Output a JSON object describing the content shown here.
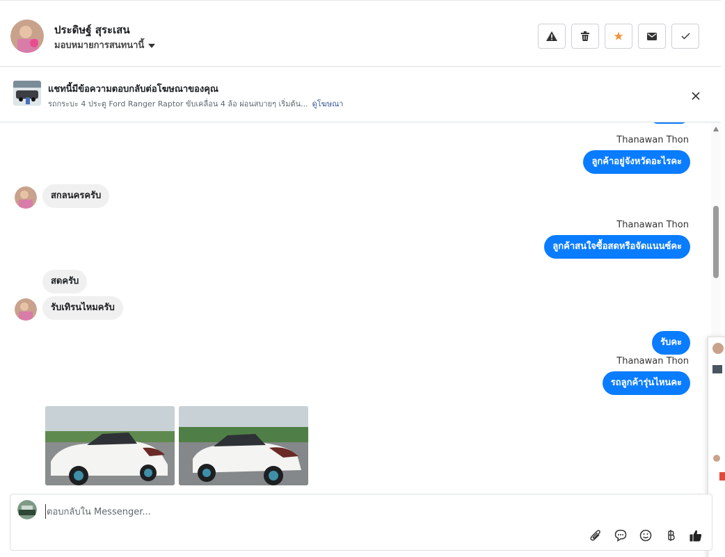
{
  "header": {
    "contact_name": "ประดิษฐ์ สุระเสน",
    "assign_label": "มอบหมายการสนทนานี้"
  },
  "ad_banner": {
    "title": "แชทนี้มีข้อความตอบกลับต่อโฆษณาของคุณ",
    "description": "รถกระบะ 4 ประตู Ford Ranger Raptor ขับเคลื่อน 4 ล้อ ผ่อนสบายๆ เริ่มต้น...",
    "link_label": "ดูโฆษณา"
  },
  "thread": {
    "messages": [
      {
        "sender": "Thanawan Thon",
        "text": "ลูกค้าอยู่จังหวัดอะไรคะ"
      },
      {
        "text": "สกลนครครับ"
      },
      {
        "sender": "Thanawan Thon",
        "text": "ลูกค้าสนใจซื้อสดหรือจัดแนนซ์คะ"
      },
      {
        "text": "สดครับ"
      },
      {
        "text": "รับเทิรนไหมครับ"
      },
      {
        "text": "รับคะ"
      },
      {
        "sender": "Thanawan Thon",
        "text": "รถลูกค้ารุ่นไหนคะ"
      }
    ]
  },
  "composer": {
    "placeholder": "ตอบกลับใน Messenger..."
  },
  "colors": {
    "outgoing_bubble": "#0a7cff",
    "incoming_bubble": "#f0f0f0",
    "star_icon": "#f7923a"
  }
}
